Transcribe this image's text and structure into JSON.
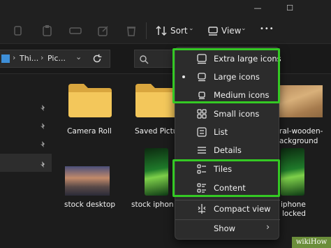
{
  "titlebar": {
    "minimize": "—",
    "maximize": "☐"
  },
  "toolbar": {
    "sort_label": "Sort",
    "view_label": "View",
    "more_label": "•••"
  },
  "address": {
    "crumb_1": "Thi...",
    "crumb_2": "Pic..."
  },
  "items": [
    {
      "label": "Camera Roll"
    },
    {
      "label": "Saved Pictu"
    },
    {
      "label": "ral-wooden-"
    },
    {
      "label": "ackground"
    },
    {
      "label": "stock desktop"
    },
    {
      "label": "stock iphone"
    },
    {
      "label": "iphone"
    },
    {
      "label": "locked"
    }
  ],
  "menu": {
    "items": [
      {
        "label": "Extra large icons",
        "icon": "extra-large-icons-icon"
      },
      {
        "label": "Large icons",
        "icon": "large-icons-icon",
        "selected": true
      },
      {
        "label": "Medium icons",
        "icon": "medium-icons-icon"
      },
      {
        "label": "Small icons",
        "icon": "small-icons-icon"
      },
      {
        "label": "List",
        "icon": "list-icon"
      },
      {
        "label": "Details",
        "icon": "details-icon"
      },
      {
        "label": "Tiles",
        "icon": "tiles-icon"
      },
      {
        "label": "Content",
        "icon": "content-icon"
      },
      {
        "label": "Compact view",
        "icon": "compact-view-icon"
      },
      {
        "label": "Show",
        "icon": ""
      }
    ],
    "show_chevron": "›"
  },
  "highlight_color": "#34c924",
  "watermark": "wikiHow"
}
